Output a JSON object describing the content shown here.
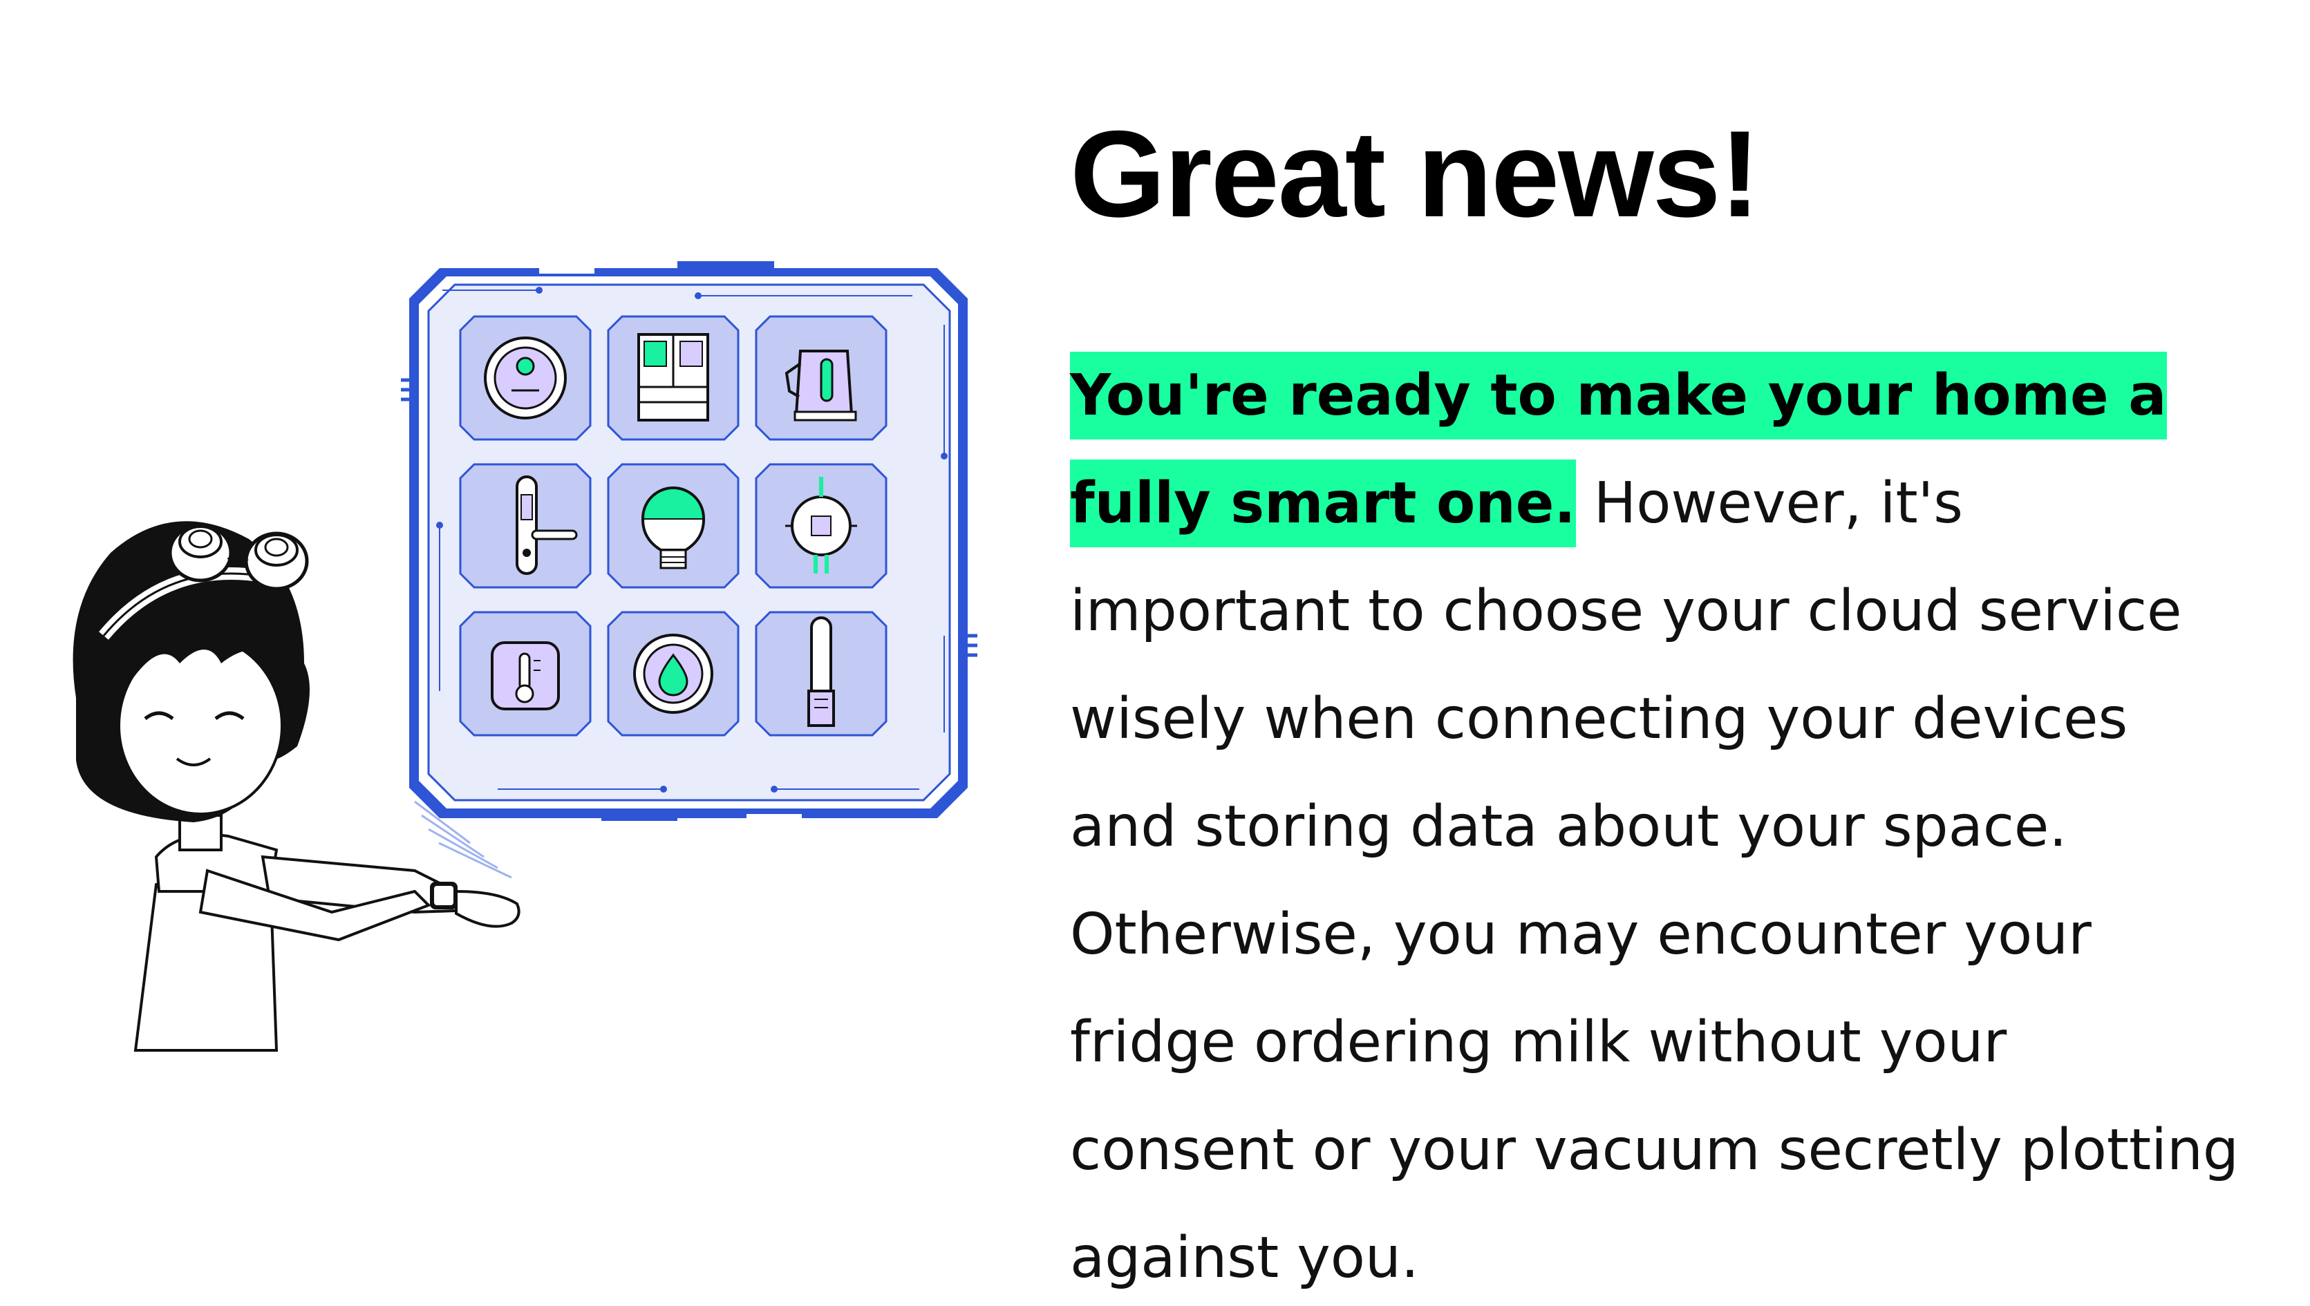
{
  "heading": "Great news!",
  "paragraph": {
    "highlight": "You're ready to make your home a fully smart one.",
    "rest": " However, it's important to choose your cloud service wisely when connecting your devices and storing data about your space. Otherwise, you may encounter your fridge ordering milk without your consent or your vacuum secretly plotting against you."
  },
  "colors": {
    "highlight": "#19ffa0",
    "panel_blue": "#2e55d6",
    "panel_fill": "#e8ecfb",
    "tile_fill": "#c3caf3",
    "device_accent": "#19f0a0",
    "device_purple": "#d9ccff"
  },
  "illustration": {
    "character": "person-with-goggles-pointing-at-smartwatch",
    "devices": [
      "robot-vacuum-icon",
      "fridge-icon",
      "kettle-icon",
      "smart-lock-icon",
      "smart-bulb-icon",
      "sensor-hub-icon",
      "thermostat-icon",
      "water-sensor-icon",
      "air-purifier-icon"
    ]
  }
}
